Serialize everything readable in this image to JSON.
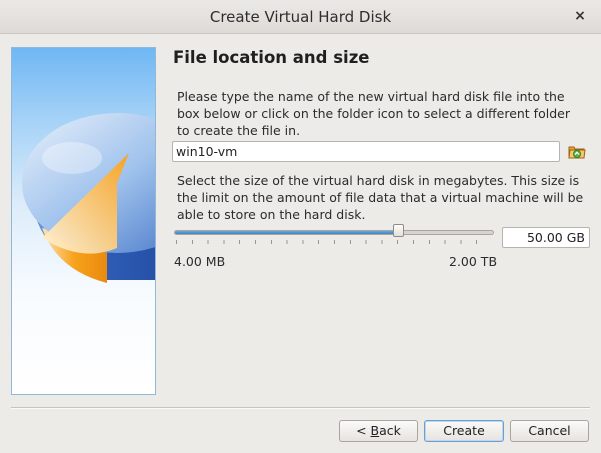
{
  "window": {
    "title": "Create Virtual Hard Disk",
    "close_symbol": "×"
  },
  "side_image": {
    "icon": "hard-disk-pie-chart-illustration"
  },
  "page": {
    "heading": "File location and size",
    "location_description": "Please type the name of the new virtual hard disk file into the box below or click on the folder icon to select a different folder to create the file in.",
    "file_name_value": "win10-vm",
    "folder_icon": "folder-select-icon",
    "size_description": "Select the size of the virtual hard disk in megabytes. This size is the limit on the amount of file data that a virtual machine will be able to store on the hard disk.",
    "size_value": "50.00 GB",
    "slider_fraction": 0.7,
    "slider_min_label": "4.00 MB",
    "slider_max_label": "2.00 TB"
  },
  "buttons": {
    "back_prefix": "< ",
    "back_mnemonic": "B",
    "back_rest": "ack",
    "create": "Create",
    "cancel": "Cancel"
  },
  "colors": {
    "accent": "#3b84c4",
    "disk_orange": "#f7a21b",
    "disk_blue": "#4f79c9"
  }
}
